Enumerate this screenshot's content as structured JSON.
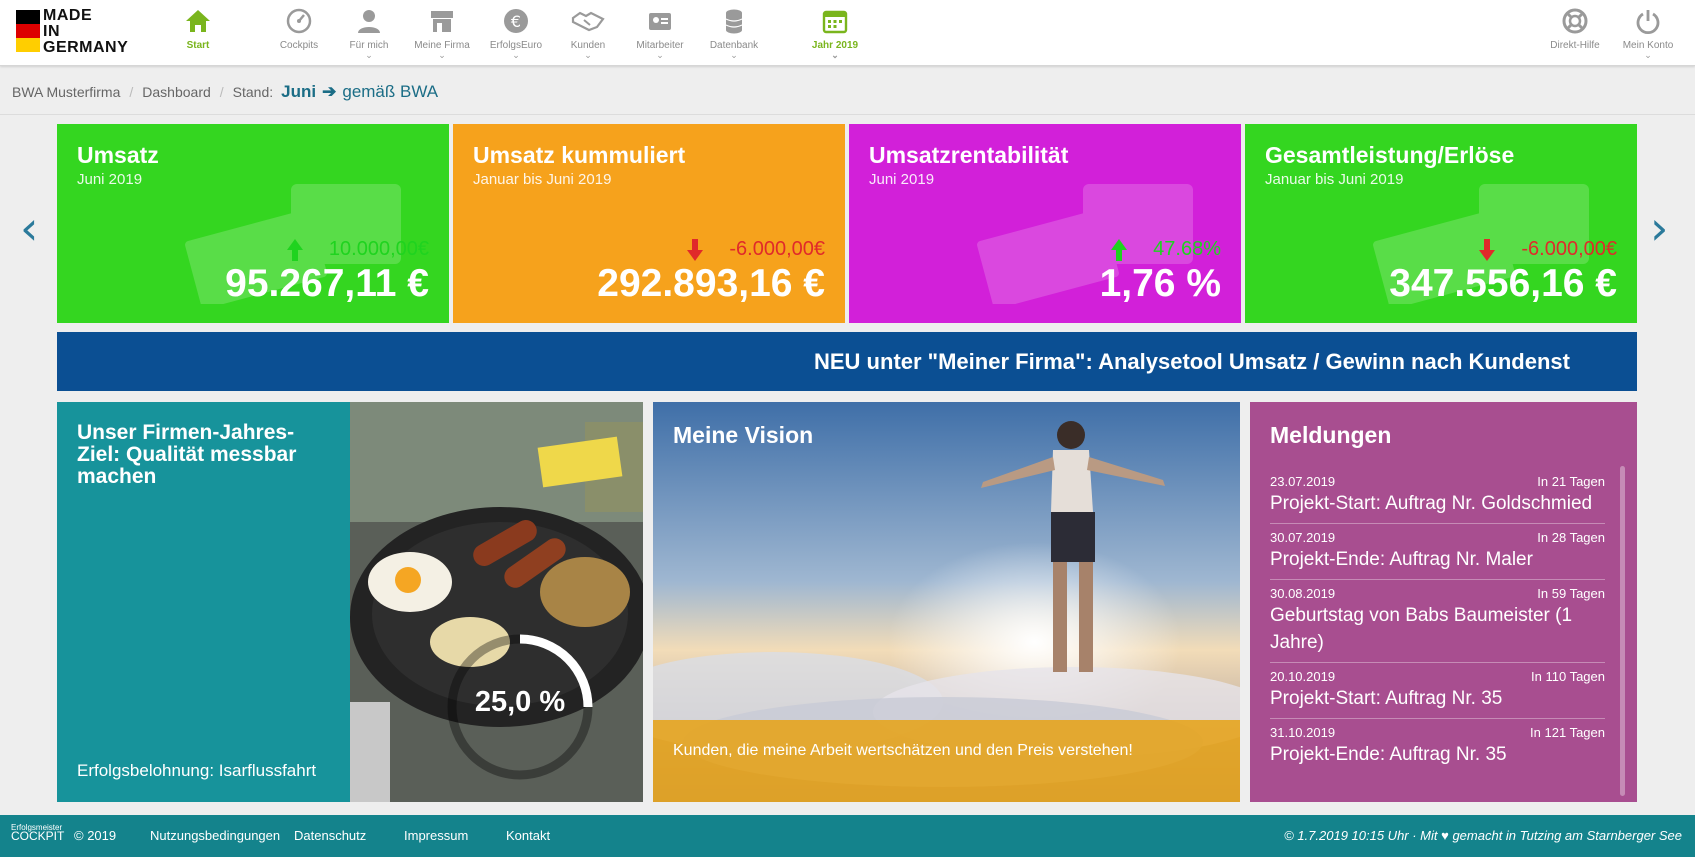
{
  "logo": {
    "line1": "MADE",
    "line2": "IN",
    "line3": "GERMANY",
    "flag_colors": [
      "#000000",
      "#dd0000",
      "#ffce00"
    ]
  },
  "nav": {
    "items": [
      {
        "label": "Start",
        "icon": "home-icon",
        "active": true
      },
      {
        "label": "Cockpits",
        "icon": "speedometer-icon"
      },
      {
        "label": "Für mich",
        "icon": "user-icon"
      },
      {
        "label": "Meine Firma",
        "icon": "store-icon"
      },
      {
        "label": "ErfolgsEuro",
        "icon": "euro-icon"
      },
      {
        "label": "Kunden",
        "icon": "handshake-icon"
      },
      {
        "label": "Mitarbeiter",
        "icon": "id-card-icon"
      },
      {
        "label": "Datenbank",
        "icon": "database-icon"
      },
      {
        "label": "Jahr 2019",
        "icon": "calendar-icon",
        "active": true
      },
      {
        "label": "Direkt-Hilfe",
        "icon": "lifebuoy-icon"
      },
      {
        "label": "Mein Konto",
        "icon": "power-icon"
      }
    ]
  },
  "breadcrumb": {
    "company": "BWA Musterfirma",
    "page": "Dashboard",
    "stand_label": "Stand:",
    "month": "Juni",
    "mode": "gemäß BWA"
  },
  "kpis": [
    {
      "title": "Umsatz",
      "period": "Juni 2019",
      "delta": "10.000,00€",
      "direction": "up",
      "value": "95.267,11 €",
      "color": "#34d620"
    },
    {
      "title": "Umsatz kummuliert",
      "period": "Januar bis Juni 2019",
      "delta": "-6.000,00€",
      "direction": "down",
      "value": "292.893,16 €",
      "color": "#f6a21c"
    },
    {
      "title": "Umsatzrentabilität",
      "period": "Juni 2019",
      "delta": "47.68%",
      "direction": "up",
      "value": "1,76 %",
      "color": "#d220d9"
    },
    {
      "title": "Gesamtleistung/Erlöse",
      "period": "Januar bis Juni 2019",
      "delta": "-6.000,00€",
      "direction": "down",
      "value": "347.556,16 €",
      "color": "#34d620"
    }
  ],
  "ticker": {
    "text": "NEU unter \"Meiner Firma\": Analysetool Umsatz / Gewinn nach Kundenst"
  },
  "goal": {
    "title": "Unser Firmen-Jahres-Ziel: Qualität messbar machen",
    "progress_label": "25,0 %",
    "progress_fraction": 0.25,
    "reward": "Erfolgsbelohnung: Isarflussfahrt"
  },
  "vision": {
    "title": "Meine Vision",
    "quote": "Kunden, die meine Arbeit wertschätzen und den Preis verstehen!"
  },
  "messages": {
    "title": "Meldungen",
    "items": [
      {
        "date": "23.07.2019",
        "due": "In 21 Tagen",
        "text": "Projekt-Start: Auftrag Nr. Goldschmied"
      },
      {
        "date": "30.07.2019",
        "due": "In 28 Tagen",
        "text": "Projekt-Ende: Auftrag Nr. Maler"
      },
      {
        "date": "30.08.2019",
        "due": "In 59 Tagen",
        "text": "Geburtstag von Babs Baumeister (1 Jahre)"
      },
      {
        "date": "20.10.2019",
        "due": "In 110 Tagen",
        "text": "Projekt-Start: Auftrag Nr. 35"
      },
      {
        "date": "31.10.2019",
        "due": "In 121 Tagen",
        "text": "Projekt-Ende: Auftrag Nr. 35"
      }
    ]
  },
  "footer": {
    "logo_small": "Erfolgsmeister",
    "logo_big": "COCKPIT",
    "copyright": "© 2019",
    "links": [
      "Nutzungsbedingungen",
      "Datenschutz",
      "Impressum",
      "Kontakt"
    ],
    "right": "© 1.7.2019 10:15 Uhr · Mit ♥ gemacht in Tutzing am Starnberger See"
  }
}
